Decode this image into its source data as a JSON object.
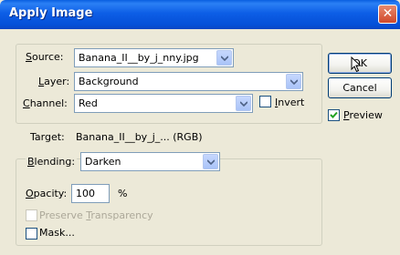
{
  "window": {
    "title": "Apply Image",
    "close_glyph": "✕"
  },
  "source_group": {
    "source_label": "Source:",
    "source_value": "Banana_II__by_j_nny.jpg",
    "layer_label": "Layer:",
    "layer_value": "Background",
    "channel_label": "Channel:",
    "channel_value": "Red",
    "invert_label": "Invert",
    "invert_checked": false
  },
  "target": {
    "label": "Target:",
    "value": "Banana_II__by_j_... (RGB)"
  },
  "blend_group": {
    "blending_label": "Blending:",
    "blending_value": "Darken",
    "opacity_label": "Opacity:",
    "opacity_value": "100",
    "opacity_unit": "%",
    "preserve_label": "Preserve Transparency",
    "preserve_checked": false,
    "mask_label": "Mask...",
    "mask_checked": false
  },
  "buttons": {
    "ok_label": "OK",
    "cancel_label": "Cancel"
  },
  "preview": {
    "label": "Preview",
    "checked": true
  },
  "colors": {
    "titlebar": "#0550d8",
    "dialog_bg": "#ece9d8",
    "check_green": "#21a121"
  }
}
